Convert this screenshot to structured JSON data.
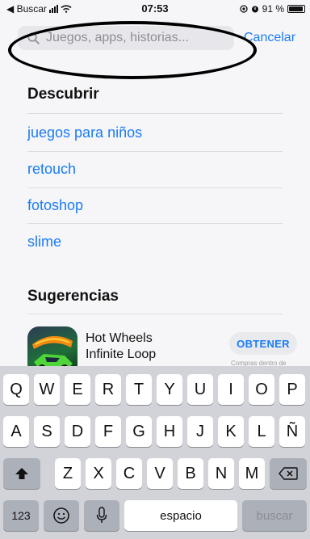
{
  "status_bar": {
    "back_label": "◀ Buscar",
    "time": "07:53",
    "battery": "91 %"
  },
  "search": {
    "placeholder": "Juegos, apps, historias...",
    "value": "",
    "cancel_label": "Cancelar"
  },
  "discover": {
    "title": "Descubrir",
    "items": [
      {
        "label": "juegos para niños"
      },
      {
        "label": "retouch"
      },
      {
        "label": "fotoshop"
      },
      {
        "label": "slime"
      }
    ]
  },
  "suggestions": {
    "title": "Sugerencias",
    "apps": [
      {
        "name_line1": "Hot Wheels",
        "name_line2": "Infinite Loop",
        "get_label": "OBTENER",
        "iap_note": "Compras dentro de"
      }
    ]
  },
  "keyboard": {
    "row1": [
      "Q",
      "W",
      "E",
      "R",
      "T",
      "Y",
      "U",
      "I",
      "O",
      "P"
    ],
    "row2": [
      "A",
      "S",
      "D",
      "F",
      "G",
      "H",
      "J",
      "K",
      "L",
      "Ñ"
    ],
    "row3": [
      "Z",
      "X",
      "C",
      "V",
      "B",
      "N",
      "M"
    ],
    "numbers_label": "123",
    "space_label": "espacio",
    "return_label": "buscar"
  },
  "colors": {
    "accent": "#1a7cf5",
    "keyboard_bg": "#d1d3d9",
    "annotation": "#000000"
  }
}
